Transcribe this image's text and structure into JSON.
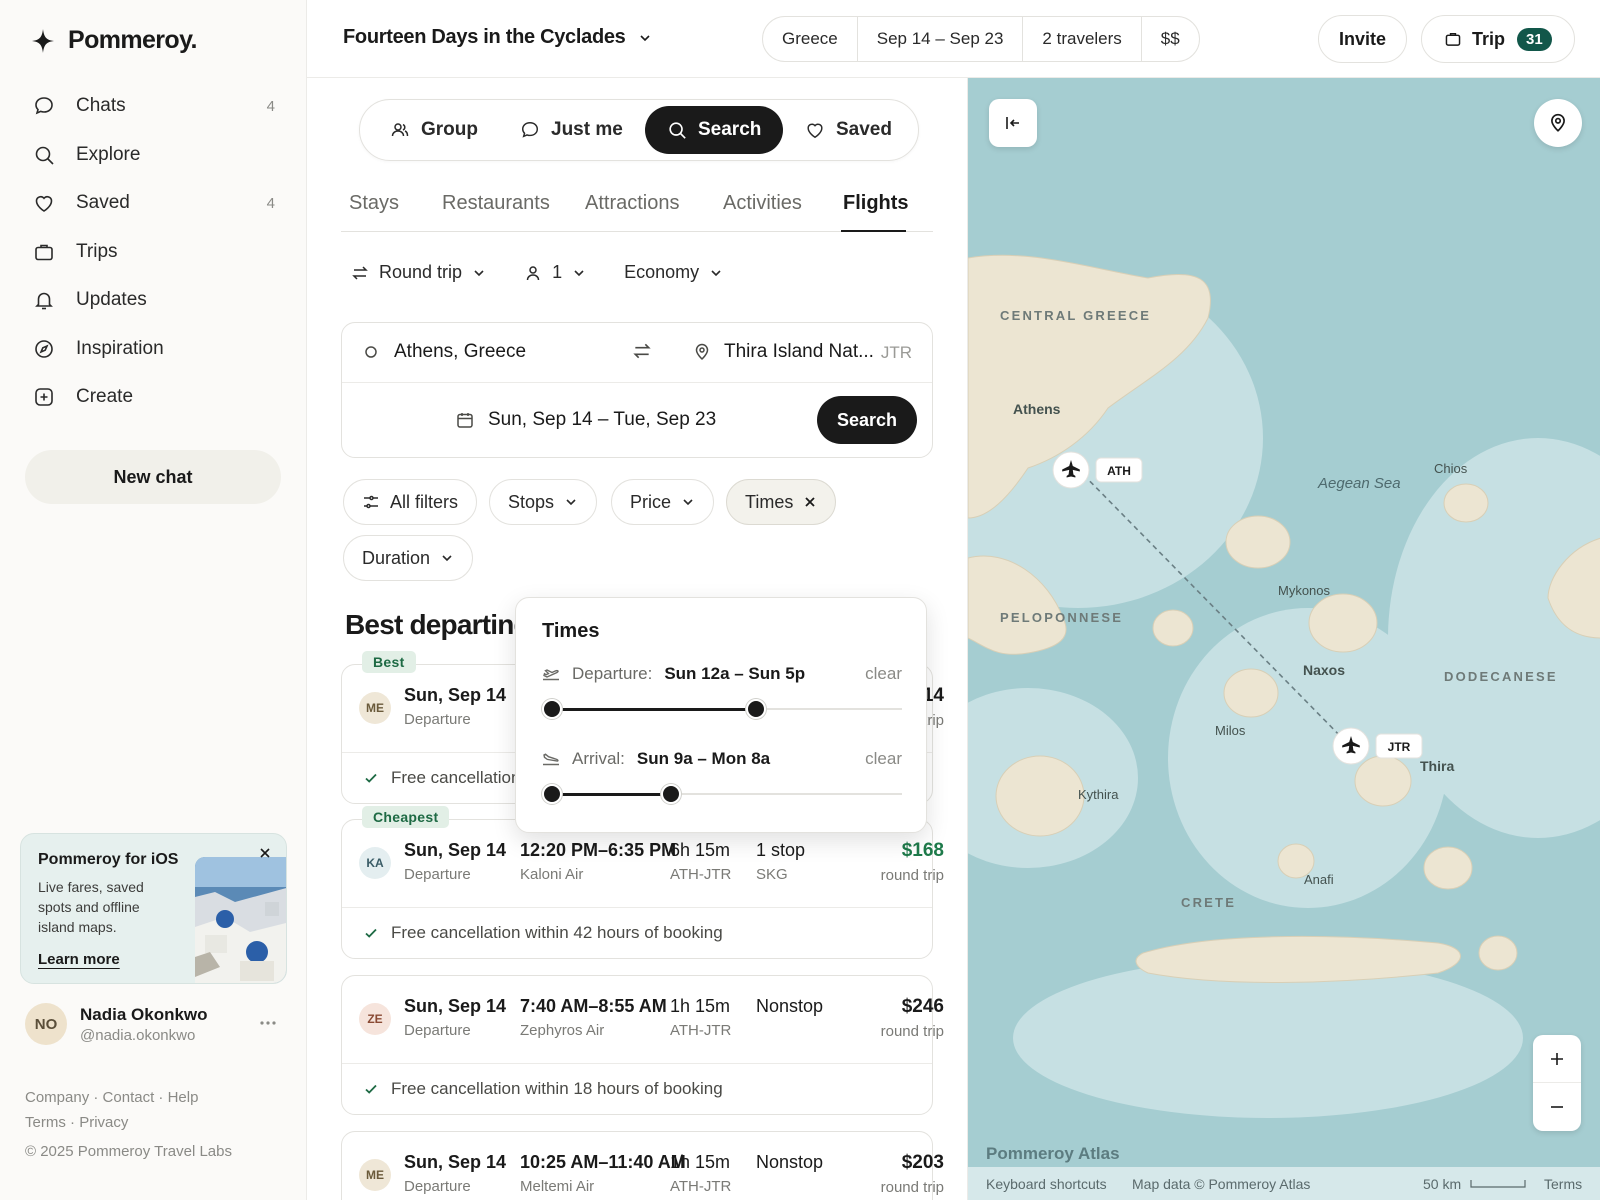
{
  "brand": {
    "name": "Pommeroy."
  },
  "sidebar": {
    "items": [
      {
        "label": "Chats",
        "count": "4",
        "icon": "chat-icon"
      },
      {
        "label": "Explore",
        "count": "",
        "icon": "search-icon"
      },
      {
        "label": "Saved",
        "count": "4",
        "icon": "heart-icon"
      },
      {
        "label": "Trips",
        "count": "",
        "icon": "briefcase-icon"
      },
      {
        "label": "Updates",
        "count": "",
        "icon": "bell-icon"
      },
      {
        "label": "Inspiration",
        "count": "",
        "icon": "compass-icon"
      },
      {
        "label": "Create",
        "count": "",
        "icon": "plus-square-icon"
      }
    ],
    "new_chat": "New chat",
    "promo": {
      "title": "Pommeroy for iOS",
      "text": "Live fares, saved spots and offline island maps.",
      "link": "Learn more"
    },
    "user": {
      "initials": "NO",
      "name": "Nadia Okonkwo",
      "handle": "@nadia.okonkwo"
    },
    "footer": {
      "company": "Company",
      "contact": "Contact",
      "help": "Help",
      "terms": "Terms",
      "privacy": "Privacy",
      "sep": "·",
      "copyright": "© 2025 Pommeroy Travel Labs"
    }
  },
  "topbar": {
    "trip_title": "Fourteen Days in the Cyclades",
    "destination": "Greece",
    "dates": "Sep 14 – Sep 23",
    "travelers": "2 travelers",
    "budget": "$$",
    "invite": "Invite",
    "trip_label": "Trip",
    "trip_count": "31"
  },
  "modes": {
    "group": "Group",
    "just_me": "Just me",
    "search": "Search",
    "saved": "Saved"
  },
  "tabs": [
    "Stays",
    "Restaurants",
    "Attractions",
    "Activities",
    "Flights"
  ],
  "trip_options": {
    "type": "Round trip",
    "passengers": "1",
    "cabin": "Economy"
  },
  "search": {
    "from": "Athens, Greece",
    "to": "Thira Island Nat...",
    "to_code": "JTR",
    "dates": "Sun, Sep 14 – Tue, Sep 23",
    "button": "Search"
  },
  "filters": {
    "all": "All filters",
    "stops": "Stops",
    "price": "Price",
    "times": "Times",
    "duration": "Duration"
  },
  "results_title": "Best departing flights",
  "flights": [
    {
      "tag": "Best",
      "airline_code": "ME",
      "av_bg": "#efe7d7",
      "av_fg": "#6a5a3a",
      "date": "Sun, Sep 14",
      "date_sub": "Departure",
      "time": "",
      "airline": "",
      "duration": "",
      "route": "",
      "stops": "",
      "stops_sub": "",
      "price": "$214",
      "price_sub": "round trip",
      "price_color": "#1a1a1a",
      "cancellation": "Free cancellation within 24 hours of booking"
    },
    {
      "tag": "Cheapest",
      "airline_code": "KA",
      "av_bg": "#e4eef0",
      "av_fg": "#3a5c66",
      "date": "Sun, Sep 14",
      "date_sub": "Departure",
      "time": "12:20 PM–6:35 PM",
      "airline": "Kaloni Air",
      "duration": "6h 15m",
      "route": "ATH-JTR",
      "stops": "1 stop",
      "stops_sub": "SKG",
      "price": "$168",
      "price_sub": "round trip",
      "price_color": "#1e7a4a",
      "cancellation": "Free cancellation within 42 hours of booking"
    },
    {
      "tag": "",
      "airline_code": "ZE",
      "av_bg": "#f6e4dc",
      "av_fg": "#8a4a34",
      "date": "Sun, Sep 14",
      "date_sub": "Departure",
      "time": "7:40 AM–8:55 AM",
      "airline": "Zephyros Air",
      "duration": "1h 15m",
      "route": "ATH-JTR",
      "stops": "Nonstop",
      "stops_sub": "",
      "price": "$246",
      "price_sub": "round trip",
      "price_color": "#1a1a1a",
      "cancellation": "Free cancellation within 18 hours of booking"
    },
    {
      "tag": "",
      "airline_code": "ME",
      "av_bg": "#efe7d7",
      "av_fg": "#6a5a3a",
      "date": "Sun, Sep 14",
      "date_sub": "Departure",
      "time": "10:25 AM–11:40 AM",
      "airline": "Meltemi Air",
      "duration": "1h 15m",
      "route": "ATH-JTR",
      "stops": "Nonstop",
      "stops_sub": "",
      "price": "$203",
      "price_sub": "round trip",
      "price_color": "#1a1a1a",
      "cancellation": ""
    }
  ],
  "times_popover": {
    "title": "Times",
    "departure_label": "Departure:",
    "departure_value": "Sun 12a – Sun 5p",
    "departure_range": [
      0,
      0.6
    ],
    "arrival_label": "Arrival:",
    "arrival_value": "Sun 9a – Mon 8a",
    "arrival_range": [
      0,
      0.35
    ],
    "clear": "clear"
  },
  "map": {
    "regions": {
      "central": "CENTRAL GREECE",
      "pelop": "PELOPONNESE",
      "dodec": "DODECANESE",
      "crete": "CRETE"
    },
    "places": {
      "athens": "Athens",
      "aegean": "Aegean Sea",
      "chios": "Chios",
      "mykonos": "Mykonos",
      "naxos": "Naxos",
      "milos": "Milos",
      "thira": "Thira",
      "kythira": "Kythira",
      "anafi": "Anafi"
    },
    "airports": {
      "from": "ATH",
      "to": "JTR"
    },
    "brand": "Pommeroy Atlas",
    "footer": {
      "shortcuts": "Keyboard shortcuts",
      "data": "Map data © Pommeroy Atlas",
      "scale": "50 km",
      "terms": "Terms"
    }
  }
}
